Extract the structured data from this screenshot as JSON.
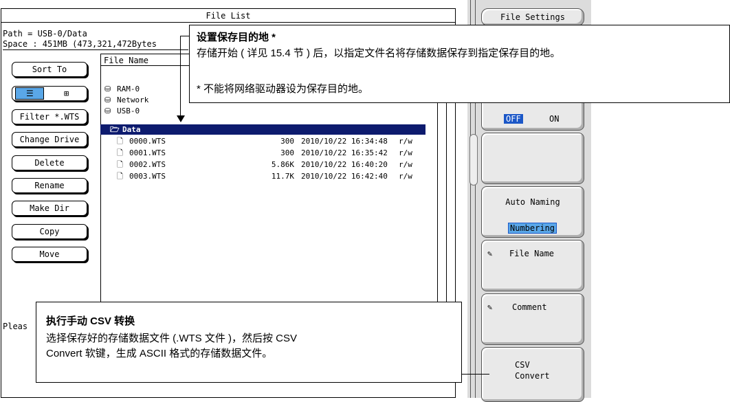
{
  "window": {
    "title": "File List",
    "path": "Path = USB-0/Data",
    "space": "Space : 451MB (473,321,472Bytes",
    "header": "File Name",
    "status_partial": "Pleas"
  },
  "side_buttons": {
    "sort": "Sort To",
    "list_icon": "☰",
    "grid_icon": "⊞",
    "filter": "Filter *.WTS",
    "change_drive": "Change Drive",
    "delete": "Delete",
    "rename": "Rename",
    "make_dir": "Make Dir",
    "copy": "Copy",
    "move": "Move"
  },
  "drives": [
    "RAM-0",
    "Network",
    "USB-0"
  ],
  "folder": "Data",
  "files": [
    {
      "name": "0000.WTS",
      "size": "300",
      "date": "2010/10/22 16:34:48",
      "attr": "r/w"
    },
    {
      "name": "0001.WTS",
      "size": "300",
      "date": "2010/10/22 16:35:42",
      "attr": "r/w"
    },
    {
      "name": "0002.WTS",
      "size": "5.86K",
      "date": "2010/10/22 16:40:20",
      "attr": "r/w"
    },
    {
      "name": "0003.WTS",
      "size": "11.7K",
      "date": "2010/10/22 16:42:40",
      "attr": "r/w"
    }
  ],
  "softkeys": {
    "file_settings": "File Settings",
    "off": "OFF",
    "on": "ON",
    "auto_naming": "Auto Naming",
    "numbering": "Numbering",
    "file_name": "File Name",
    "comment": "Comment",
    "csv_line1": "CSV",
    "csv_line2": "Convert"
  },
  "callout_top": {
    "title": "设置保存目的地 *",
    "body": "存储开始 ( 详见 15.4 节 ) 后，以指定文件名将存储数据保存到指定保存目的地。",
    "note": "* 不能将网络驱动器设为保存目的地。"
  },
  "callout_bottom": {
    "title": "执行手动 CSV 转换",
    "line1": "选择保存好的存储数据文件 (.WTS 文件 )，然后按 CSV",
    "line2": "Convert 软键，生成 ASCII 格式的存储数据文件。"
  }
}
